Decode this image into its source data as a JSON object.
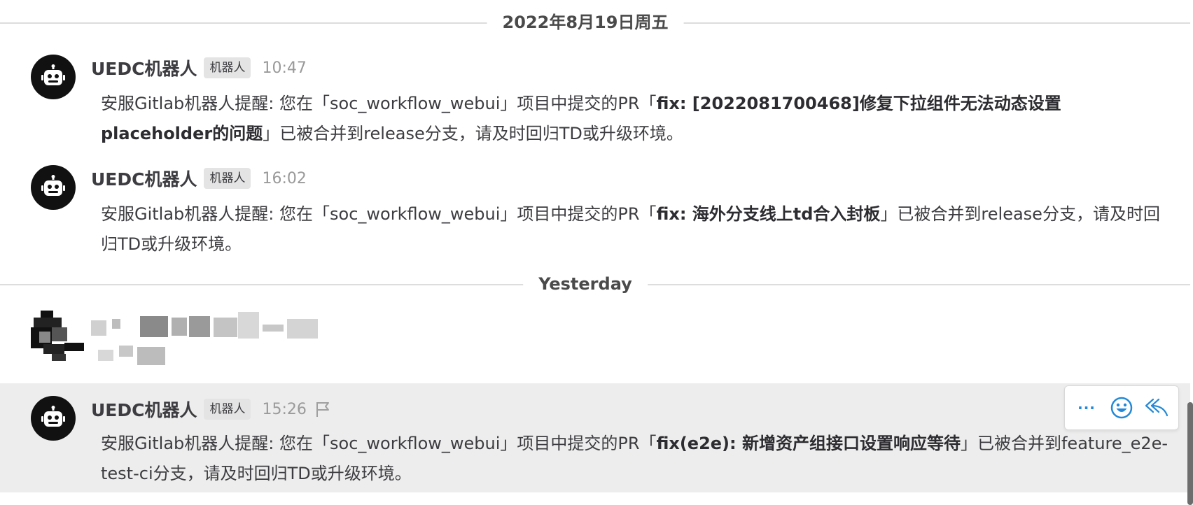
{
  "dividers": {
    "date1": "2022年8月19日周五",
    "date2": "Yesterday"
  },
  "posts": [
    {
      "username": "UEDC机器人",
      "tag": "机器人",
      "time": "10:47",
      "msg_prefix": "安服Gitlab机器人提醒: 您在「",
      "project": "soc_workflow_webui",
      "msg_mid": "」项目中提交的PR「",
      "pr_title": "fix: [2022081700468]修复下拉组件无法动态设置placeholder的问题",
      "msg_suffix": "」已被合并到release分支，请及时回归TD或升级环境。"
    },
    {
      "username": "UEDC机器人",
      "tag": "机器人",
      "time": "16:02",
      "msg_prefix": "安服Gitlab机器人提醒: 您在「",
      "project": "soc_workflow_webui",
      "msg_mid": "」项目中提交的PR「",
      "pr_title": "fix: 海外分支线上td合入封板",
      "msg_suffix": "」已被合并到release分支，请及时回归TD或升级环境。"
    },
    {
      "username": "UEDC机器人",
      "tag": "机器人",
      "time": "15:26",
      "msg_prefix": "安服Gitlab机器人提醒: 您在「",
      "project": "soc_workflow_webui",
      "msg_mid": "」项目中提交的PR「",
      "pr_title": "fix(e2e): 新增资产组接口设置响应等待",
      "msg_suffix_a": "」已被合并到",
      "branch": "feature_e2e-test-ci",
      "msg_suffix_b": "分支，请及时回归TD或升级环境。"
    }
  ],
  "hover_menu": {
    "more_label": "···"
  },
  "icons": {
    "avatar": "robot-icon",
    "flag": "flag-icon",
    "emoji": "smiley-icon",
    "reply": "reply-icon"
  },
  "colors": {
    "accent": "#2389d7",
    "highlight_bg": "#ededed",
    "tag_bg": "#e4e4e4"
  }
}
